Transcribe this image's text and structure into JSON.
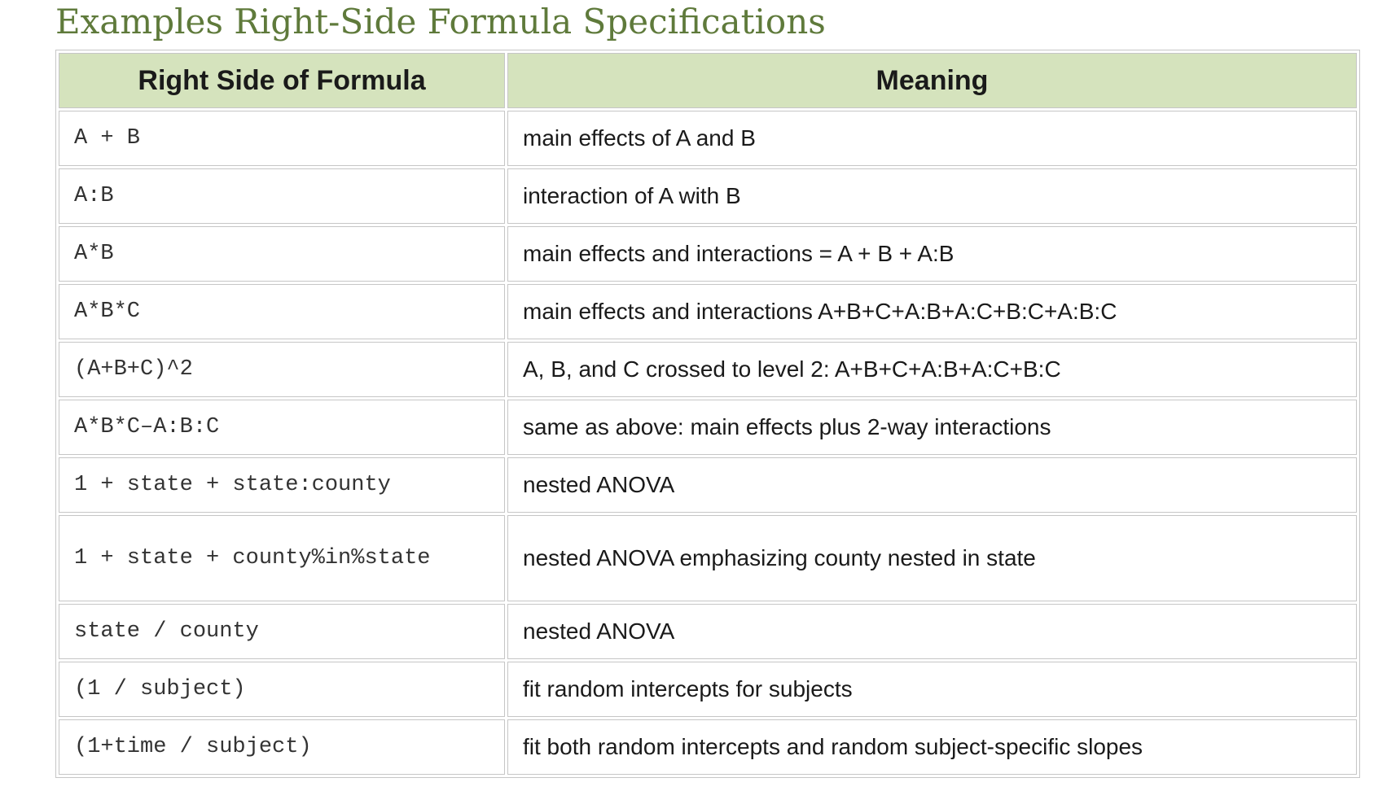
{
  "title": "Examples Right-Side Formula Specifications",
  "table": {
    "headers": {
      "formula": "Right Side of Formula",
      "meaning": "Meaning"
    },
    "rows": [
      {
        "formula": "A + B",
        "meaning": "main effects of A and B"
      },
      {
        "formula": "A:B",
        "meaning": "interaction of A with B"
      },
      {
        "formula": "A*B",
        "meaning": "main effects and interactions = A + B + A:B"
      },
      {
        "formula": "A*B*C",
        "meaning": "main effects and interactions A+B+C+A:B+A:C+B:C+A:B:C"
      },
      {
        "formula": "(A+B+C)^2",
        "meaning": "A, B, and C crossed to level 2: A+B+C+A:B+A:C+B:C"
      },
      {
        "formula": "A*B*C–A:B:C",
        "meaning": "same as above: main effects plus 2-way interactions"
      },
      {
        "formula": "1 + state + state:county",
        "meaning": "nested ANOVA"
      },
      {
        "formula": "1 + state + county%in%state",
        "meaning": "nested ANOVA emphasizing county nested in state"
      },
      {
        "formula": "state / county",
        "meaning": "nested ANOVA"
      },
      {
        "formula": "(1 / subject)",
        "meaning": "fit random intercepts for subjects"
      },
      {
        "formula": "(1+time / subject)",
        "meaning": "fit both random intercepts and random subject-specific slopes"
      }
    ]
  },
  "colors": {
    "title": "#5f7a3b",
    "header_background": "#d5e3bd",
    "border": "#c6c6c6"
  }
}
